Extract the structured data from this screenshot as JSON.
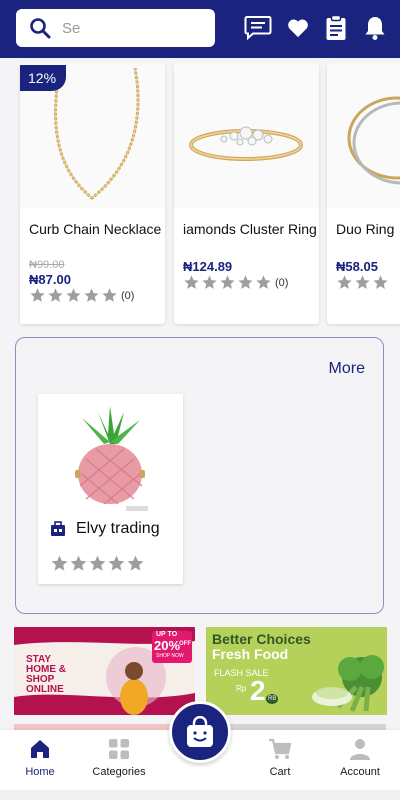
{
  "header": {
    "search_placeholder": "Se",
    "icons": [
      "search-icon",
      "chat-icon",
      "heart-icon",
      "clipboard-icon",
      "bell-icon"
    ]
  },
  "products": [
    {
      "name": "Curb Chain Necklace",
      "discount": "12%",
      "old_price": "₦99.00",
      "price": "₦87.00",
      "rating_count": "(0)",
      "image": "gold-chain-necklace"
    },
    {
      "name": "iamonds Cluster Ring",
      "price": "₦124.89",
      "rating_count": "(0)",
      "image": "diamond-cluster-ring"
    },
    {
      "name": "Duo Ring",
      "price": "₦58.05",
      "image": "gold-duo-ring"
    }
  ],
  "shop_section": {
    "more_label": "More",
    "shop": {
      "name": "Elvy trading",
      "image": "pink-pineapple-bag",
      "stars": 5
    }
  },
  "banners": {
    "left": {
      "lines": [
        "STAY",
        "HOME &",
        "SHOP",
        "ONLINE"
      ],
      "up_to": "UP TO",
      "percent": "20%",
      "off": "OFF",
      "shop_now": "SHOP NOW"
    },
    "right": {
      "line1": "Better Choices",
      "line2": "Fresh Food",
      "flash": "FLASH",
      "sale": "SALE",
      "currency": "Rp",
      "amount": "2",
      "suffix": "RB"
    }
  },
  "bottom_nav": {
    "items": [
      {
        "label": "Home",
        "icon": "home-icon",
        "active": true
      },
      {
        "label": "Categories",
        "icon": "grid-icon",
        "active": false
      },
      {
        "label": "Cart",
        "icon": "cart-icon",
        "active": false
      },
      {
        "label": "Account",
        "icon": "person-icon",
        "active": false
      }
    ],
    "center_icon": "shopping-bag-icon"
  },
  "colors": {
    "primary": "#1a237e",
    "star": "#9e9e9e",
    "accent_pink": "#c2185b",
    "banner_green": "#b5d15a"
  }
}
